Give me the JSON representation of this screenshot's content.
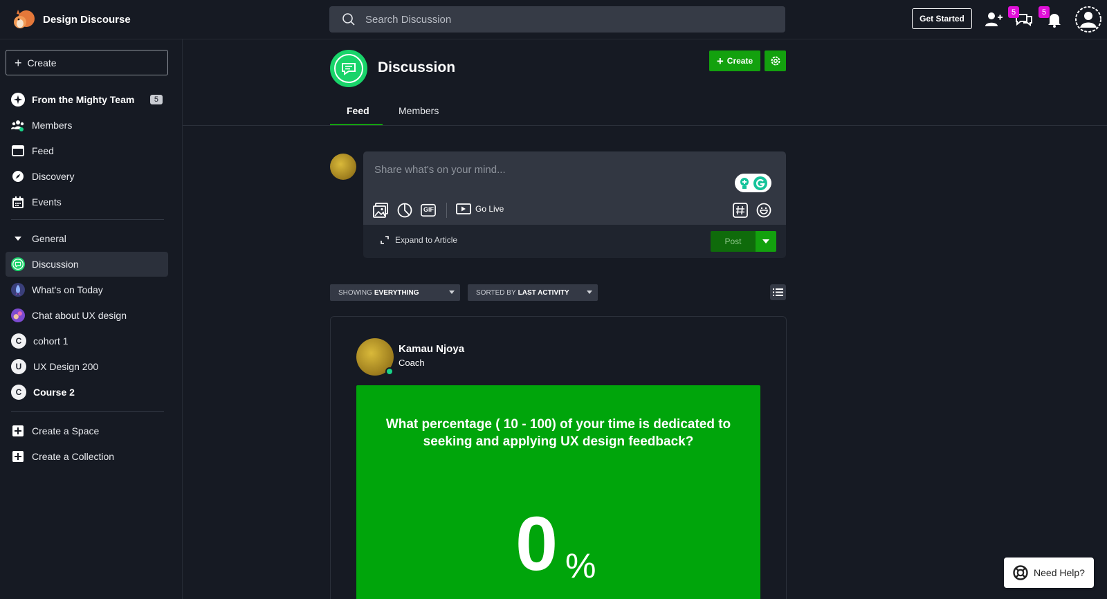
{
  "brand": {
    "name": "Design Discourse"
  },
  "search": {
    "placeholder": "Search Discussion"
  },
  "topbar": {
    "get_started": "Get Started",
    "chat_badge": "5",
    "notif_badge": "5"
  },
  "sidebar": {
    "create_label": "Create",
    "primary": [
      {
        "label": "From the Mighty Team",
        "count": "5"
      },
      {
        "label": "Members"
      },
      {
        "label": "Feed"
      },
      {
        "label": "Discovery"
      },
      {
        "label": "Events"
      }
    ],
    "collection_label": "General",
    "spaces": [
      {
        "label": "Discussion"
      },
      {
        "label": "What's on Today"
      },
      {
        "label": "Chat about UX design"
      },
      {
        "label": "cohort 1",
        "letter": "C"
      },
      {
        "label": "UX Design 200",
        "letter": "U"
      },
      {
        "label": "Course 2",
        "letter": "C"
      }
    ],
    "create_space": "Create a Space",
    "create_collection": "Create a Collection"
  },
  "header": {
    "title": "Discussion",
    "create_label": "Create",
    "tabs": [
      {
        "label": "Feed"
      },
      {
        "label": "Members"
      }
    ]
  },
  "composer": {
    "placeholder": "Share what's on your mind...",
    "go_live": "Go Live",
    "gif_label": "GIF",
    "expand": "Expand to Article",
    "post": "Post"
  },
  "filters": {
    "showing_prefix": "SHOWING",
    "showing_value": "EVERYTHING",
    "sorted_prefix": "SORTED BY",
    "sorted_value": "LAST ACTIVITY"
  },
  "post": {
    "author": "Kamau Njoya",
    "role": "Coach",
    "poll_question": "What percentage ( 10 - 100) of your time is dedicated to seeking and applying UX design feedback?",
    "poll_value": "0",
    "poll_unit": "%"
  },
  "help": {
    "label": "Need Help?"
  },
  "colors": {
    "accent": "#13a10e",
    "poll_bg": "#00a50b",
    "badge": "#e10fd8",
    "background": "#161a23"
  }
}
